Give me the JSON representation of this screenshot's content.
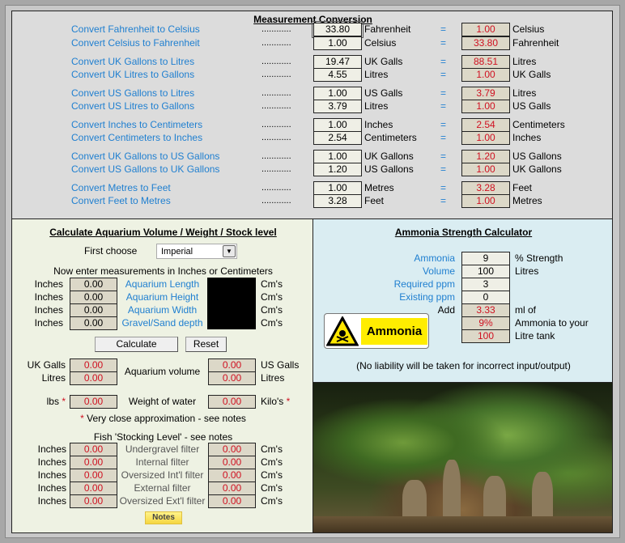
{
  "conversion": {
    "title": "Measurement Conversion",
    "dots": "............",
    "eq": "=",
    "rows": [
      {
        "label": "Convert Fahrenheit to Celsius",
        "input": "33.80",
        "in_unit": "Fahrenheit",
        "result": "1.00",
        "out_unit": "Celsius"
      },
      {
        "label": "Convert Celsius to Fahrenheit",
        "input": "1.00",
        "in_unit": "Celsius",
        "result": "33.80",
        "out_unit": "Fahrenheit"
      },
      {
        "label": "Convert UK Gallons to Litres",
        "input": "19.47",
        "in_unit": "UK Galls",
        "result": "88.51",
        "out_unit": "Litres"
      },
      {
        "label": "Convert UK Litres to Gallons",
        "input": "4.55",
        "in_unit": "Litres",
        "result": "1.00",
        "out_unit": "UK Galls"
      },
      {
        "label": "Convert US Gallons to Litres",
        "input": "1.00",
        "in_unit": "US Galls",
        "result": "3.79",
        "out_unit": "Litres"
      },
      {
        "label": "Convert US Litres to Gallons",
        "input": "3.79",
        "in_unit": "Litres",
        "result": "1.00",
        "out_unit": "US Galls"
      },
      {
        "label": "Convert Inches to Centimeters",
        "input": "1.00",
        "in_unit": "Inches",
        "result": "2.54",
        "out_unit": "Centimeters"
      },
      {
        "label": "Convert Centimeters to Inches",
        "input": "2.54",
        "in_unit": "Centimeters",
        "result": "1.00",
        "out_unit": "Inches"
      },
      {
        "label": "Convert UK Gallons to US Gallons",
        "input": "1.00",
        "in_unit": "UK Gallons",
        "result": "1.20",
        "out_unit": "US Gallons"
      },
      {
        "label": "Convert US Gallons to UK Gallons",
        "input": "1.20",
        "in_unit": "US Gallons",
        "result": "1.00",
        "out_unit": "UK Gallons"
      },
      {
        "label": "Convert Metres to Feet",
        "input": "1.00",
        "in_unit": "Metres",
        "result": "3.28",
        "out_unit": "Feet"
      },
      {
        "label": "Convert Feet to Metres",
        "input": "3.28",
        "in_unit": "Feet",
        "result": "1.00",
        "out_unit": "Metres"
      }
    ]
  },
  "aquarium": {
    "title": "Calculate Aquarium Volume / Weight / Stock level",
    "first_choose": "First choose",
    "unit_select": "Imperial",
    "instructions": "Now enter measurements in Inches or Centimeters",
    "dims": [
      {
        "left_unit": "Inches",
        "value": "0.00",
        "label": "Aquarium Length",
        "right_unit": "Cm's"
      },
      {
        "left_unit": "Inches",
        "value": "0.00",
        "label": "Aquarium Height",
        "right_unit": "Cm's"
      },
      {
        "left_unit": "Inches",
        "value": "0.00",
        "label": "Aquarium Width",
        "right_unit": "Cm's"
      },
      {
        "left_unit": "Inches",
        "value": "0.00",
        "label": "Gravel/Sand depth",
        "right_unit": "Cm's"
      }
    ],
    "calculate": "Calculate",
    "reset": "Reset",
    "volume_label": "Aquarium volume",
    "volume": [
      {
        "left_unit": "UK Galls",
        "left": "0.00",
        "right": "0.00",
        "right_unit": "US Galls"
      },
      {
        "left_unit": "Litres",
        "left": "0.00",
        "right": "0.00",
        "right_unit": "Litres"
      }
    ],
    "weight": {
      "left_unit": "lbs",
      "left": "0.00",
      "label": "Weight of water",
      "right": "0.00",
      "right_unit": "Kilo's",
      "star": "*"
    },
    "approx_star": "*",
    "approx_note": " Very close approximation - see notes",
    "stocking_title": "Fish 'Stocking Level' - see notes",
    "stocking": [
      {
        "left_unit": "Inches",
        "left": "0.00",
        "label": "Undergravel filter",
        "right": "0.00",
        "right_unit": "Cm's"
      },
      {
        "left_unit": "Inches",
        "left": "0.00",
        "label": "Internal filter",
        "right": "0.00",
        "right_unit": "Cm's"
      },
      {
        "left_unit": "Inches",
        "left": "0.00",
        "label": "Oversized Int'l filter",
        "right": "0.00",
        "right_unit": "Cm's"
      },
      {
        "left_unit": "Inches",
        "left": "0.00",
        "label": "External filter",
        "right": "0.00",
        "right_unit": "Cm's"
      },
      {
        "left_unit": "Inches",
        "left": "0.00",
        "label": "Oversized Ext'l filter",
        "right": "0.00",
        "right_unit": "Cm's"
      }
    ],
    "notes": "Notes"
  },
  "ammonia": {
    "title": "Ammonia Strength Calculator",
    "rows": [
      {
        "label": "Ammonia",
        "value": "9",
        "unit": "%  Strength",
        "input": true
      },
      {
        "label": "Volume",
        "value": "100",
        "unit": "Litres",
        "input": true
      },
      {
        "label": "Required ppm",
        "value": "3",
        "unit": "",
        "input": true
      },
      {
        "label": "Existing ppm",
        "value": "0",
        "unit": "",
        "input": true
      },
      {
        "label": "Add",
        "value": "3.33",
        "unit": "ml of",
        "input": false
      },
      {
        "label": "",
        "value": "9%",
        "unit": "Ammonia to your",
        "input": false
      },
      {
        "label": "",
        "value": "100",
        "unit": "Litre tank",
        "input": false
      }
    ],
    "sign_text": "Ammonia",
    "disclaimer": "(No liability will be taken for incorrect input/output)"
  }
}
